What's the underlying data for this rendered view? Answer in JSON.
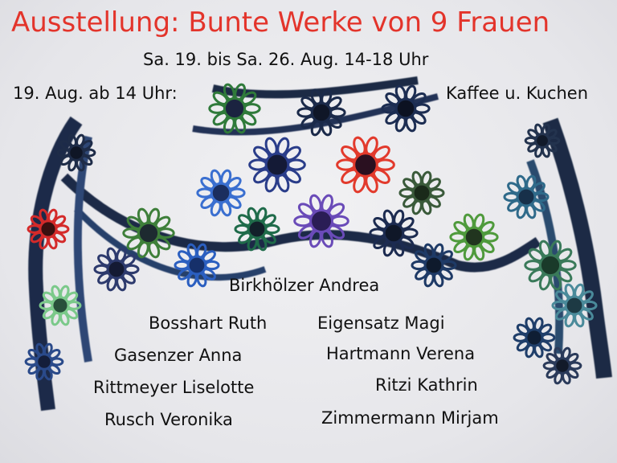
{
  "poster": {
    "title": "Ausstellung: Bunte Werke von 9 Frauen",
    "dates": "Sa. 19. bis Sa. 26. Aug. 14-18 Uhr",
    "opening": "19. Aug. ab 14 Uhr:",
    "refreshments": "Kaffee u. Kuchen",
    "names": [
      "Birkhölzer Andrea",
      "Bosshart Ruth",
      "Eigensatz Magi",
      "Gasenzer Anna",
      "Hartmann Verena",
      "Rittmeyer Liselotte",
      "Ritzi Kathrin",
      "Rusch Veronika",
      "Zimmermann Mirjam"
    ]
  },
  "colors": {
    "title": "#e3342b",
    "text": "#111111",
    "background": "#e9e9ec"
  },
  "image": {
    "subject": "crocheted-shawl-photo"
  }
}
